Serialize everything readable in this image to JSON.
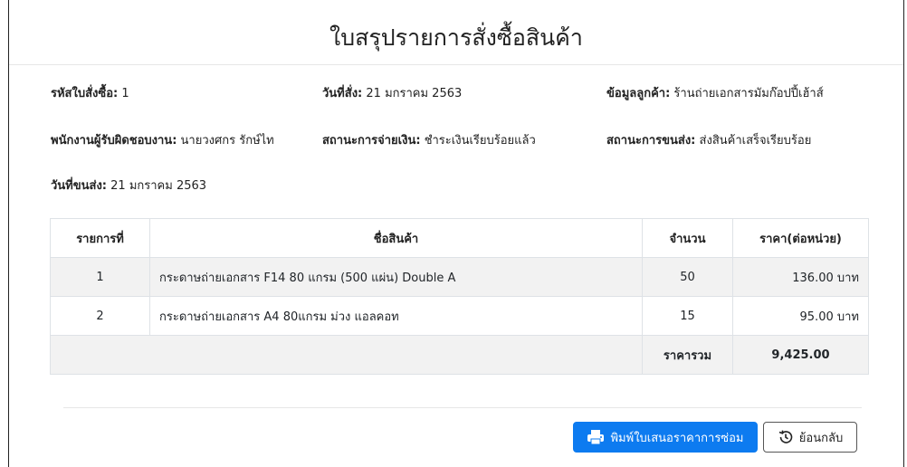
{
  "page": {
    "title": "ใบสรุปรายการสั่งซื้อสินค้า"
  },
  "info": {
    "order_id_label": "รหัสใบสั่งซื้อ:",
    "order_id_value": "1",
    "order_date_label": "วันที่สั่ง:",
    "order_date_value": "21 มกราคม 2563",
    "customer_label": "ข้อมูลลูกค้า:",
    "customer_value": "ร้านถ่ายเอกสารมัมก๊อปปี้เฮ้าส์",
    "staff_label": "พนักงานผู้รับผิดชอบงาน:",
    "staff_value": "นายวงศกร รักษ์ไท",
    "payment_label": "สถานะการจ่ายเงิน:",
    "payment_value": "ชำระเงินเรียบร้อยแล้ว",
    "shipping_label": "สถานะการขนส่ง:",
    "shipping_value": "ส่งสินค้าเสร็จเรียบร้อย",
    "ship_date_label": "วันที่ขนส่ง:",
    "ship_date_value": "21 มกราคม 2563"
  },
  "table": {
    "headers": [
      "รายการที่",
      "ชื่อสินค้า",
      "จำนวน",
      "ราคา(ต่อหน่วย)"
    ],
    "rows": [
      {
        "no": "1",
        "name": "กระดาษถ่ายเอกสาร F14 80 แกรม (500 แผ่น) Double A",
        "qty": "50",
        "price": "136.00 บาท"
      },
      {
        "no": "2",
        "name": "กระดาษถ่ายเอกสาร A4 80แกรม ม่วง แอลคอท",
        "qty": "15",
        "price": "95.00 บาท"
      }
    ],
    "total_label": "ราคารวม",
    "total_value": "9,425.00"
  },
  "buttons": {
    "print_label": "พิมพ์ใบเสนอราคาการซ่อม",
    "print_icon": "printer-icon",
    "back_label": "ย้อนกลับ",
    "back_icon": "history-back-icon"
  },
  "colors": {
    "primary": "#0d7bf0",
    "stripe": "#f2f2f2"
  }
}
